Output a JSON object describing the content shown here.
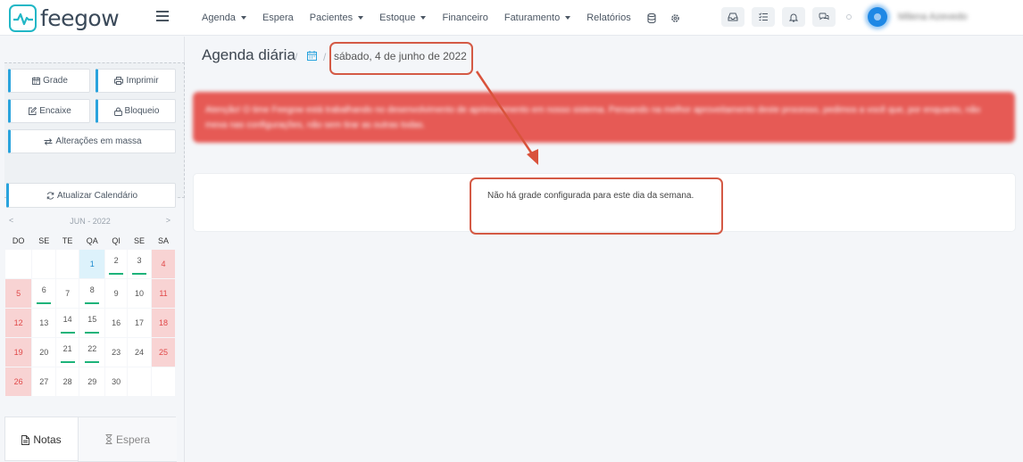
{
  "app": {
    "logo_text": "feegow"
  },
  "nav": {
    "items": [
      {
        "label": "Agenda",
        "dropdown": true
      },
      {
        "label": "Espera",
        "dropdown": false
      },
      {
        "label": "Pacientes",
        "dropdown": true
      },
      {
        "label": "Estoque",
        "dropdown": true
      },
      {
        "label": "Financeiro",
        "dropdown": false
      },
      {
        "label": "Faturamento",
        "dropdown": true
      },
      {
        "label": "Relatórios",
        "dropdown": false
      }
    ],
    "icons": [
      "database-icon",
      "settings-icon"
    ]
  },
  "top_right": {
    "buttons": [
      "inbox-icon",
      "task-list-icon",
      "bell-icon",
      "chat-icon"
    ],
    "user_name": "Milena Azevedo"
  },
  "sidebar": {
    "buttons": {
      "grade": "Grade",
      "imprimir": "Imprimir",
      "encaixe": "Encaixe",
      "bloqueio": "Bloqueio",
      "alteracoes": "Alterações em massa",
      "atualizar": "Atualizar Calendário"
    },
    "calendar": {
      "title": "JUN - 2022",
      "prev": "<",
      "next": ">",
      "weekdays": [
        "DO",
        "SE",
        "TE",
        "QA",
        "QI",
        "SE",
        "SA"
      ],
      "weeks": [
        [
          "",
          "",
          "",
          "1",
          "2",
          "3",
          "4"
        ],
        [
          "5",
          "6",
          "7",
          "8",
          "9",
          "10",
          "11"
        ],
        [
          "12",
          "13",
          "14",
          "15",
          "16",
          "17",
          "18"
        ],
        [
          "19",
          "20",
          "21",
          "22",
          "23",
          "24",
          "25"
        ],
        [
          "26",
          "27",
          "28",
          "29",
          "30",
          "",
          ""
        ]
      ],
      "today": "1",
      "marked_days": [
        "2",
        "3",
        "6",
        "8",
        "14",
        "15",
        "21",
        "22"
      ]
    },
    "tabs": {
      "notas": "Notas",
      "espera": "Espera"
    }
  },
  "main": {
    "title": "Agenda diária",
    "crumb_sep": "/",
    "date": "sábado, 4 de junho de 2022",
    "alert_text": "Atenção! O time Feegow está trabalhando no desenvolvimento de aprimoramento em nosso sistema. Pensando na melhor aproveitamento deste processo, pedimos a você que, por enquanto, não mexa nas configurações, não sem tirar as outras todas.",
    "empty_message": "Não há grade configurada para este dia da semana."
  },
  "colors": {
    "accent": "#29a3dd",
    "alert": "#e65a55",
    "highlight": "#d45a45",
    "weekend": "#f8d3d3",
    "marker": "#1db37a"
  }
}
